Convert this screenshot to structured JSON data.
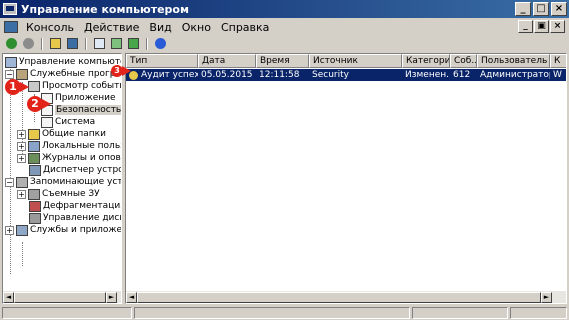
{
  "window": {
    "title": "Управление компьютером"
  },
  "menubar": {
    "items": [
      "Консоль",
      "Действие",
      "Вид",
      "Окно",
      "Справка"
    ]
  },
  "toolbar": {
    "icons": [
      "back-icon",
      "forward-icon",
      "up-icon",
      "show-tree-icon",
      "properties-icon",
      "refresh-icon",
      "export-icon",
      "help-icon"
    ]
  },
  "tree": {
    "items": [
      {
        "label": "Управление компьютером (л",
        "icon": "computer-icon",
        "expander": ""
      },
      {
        "label": "Служебные программ",
        "icon": "tools-icon",
        "expander": "−"
      },
      {
        "label": "Просмотр событий",
        "icon": "event-viewer-icon",
        "expander": ""
      },
      {
        "label": "Приложение",
        "icon": "log-icon",
        "expander": ""
      },
      {
        "label": "Безопасность",
        "icon": "log-icon",
        "expander": ""
      },
      {
        "label": "Система",
        "icon": "log-icon",
        "expander": ""
      },
      {
        "label": "Общие папки",
        "icon": "folder-icon",
        "expander": "+"
      },
      {
        "label": "Локальные пользова",
        "icon": "users-icon",
        "expander": "+"
      },
      {
        "label": "Журналы и оповещен",
        "icon": "perf-logs-icon",
        "expander": "+"
      },
      {
        "label": "Диспетчер устройств",
        "icon": "device-manager-icon",
        "expander": ""
      },
      {
        "label": "Запоминающие устройст",
        "icon": "storage-icon",
        "expander": "−"
      },
      {
        "label": "Съемные ЗУ",
        "icon": "removable-storage-icon",
        "expander": "+"
      },
      {
        "label": "Дефрагментация дис",
        "icon": "defrag-icon",
        "expander": ""
      },
      {
        "label": "Управление дисками",
        "icon": "disk-management-icon",
        "expander": ""
      },
      {
        "label": "Службы и приложения",
        "icon": "services-icon",
        "expander": "+"
      }
    ]
  },
  "list": {
    "columns": [
      "Тип",
      "Дата",
      "Время",
      "Источник",
      "Категория",
      "Соб...",
      "Пользователь",
      "К"
    ],
    "rows": [
      [
        "Аудит успехов",
        "05.05.2015",
        "12:11:58",
        "Security",
        "Изменен...",
        "612",
        "Администратор",
        "W"
      ]
    ]
  },
  "markers": [
    "1",
    "2",
    "3"
  ],
  "colors": {
    "selection": "#0a246a",
    "marker": "#e2231a",
    "titlebar": "#0a246a"
  }
}
